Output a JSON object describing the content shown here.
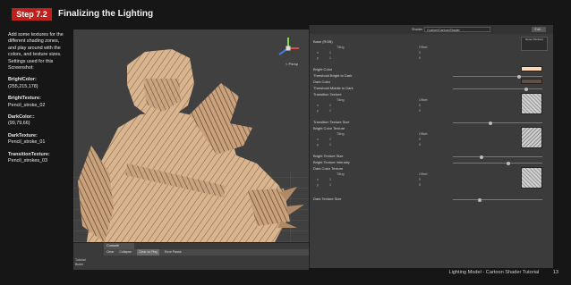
{
  "slide": {
    "step": "Step 7.2",
    "title": "Finalizing the Lighting",
    "footer_text": "Lighting Model - Cartoon Shader Tutorial",
    "page_number": "13"
  },
  "notes": {
    "intro": "Add some textures for the different shading zones, and play around with the colors, and texture sizes. Settings used for this Screenshot:",
    "items": [
      {
        "key": "BrightColor:",
        "value": "(255,215,178)"
      },
      {
        "key": "BrightTexture:",
        "value": "Pencil_stroke_02"
      },
      {
        "key": "DarkColor::",
        "value": "(99,79,66)"
      },
      {
        "key": "DarkTexture:",
        "value": "Pencil_stroke_01"
      },
      {
        "key": "TransitionTexture:",
        "value": "Pencil_strokes_03"
      }
    ]
  },
  "viewport": {
    "persp_label": "< Persp"
  },
  "console": {
    "tab_label": "Console",
    "buttons": [
      "Clear",
      "Collapse",
      "Clear on Play",
      "Error Pause"
    ],
    "hierarchy_items": [
      "Tutorial",
      "Bullet"
    ]
  },
  "inspector": {
    "shader_label": "Shader",
    "shader_value": "Custom/CartoonShader",
    "edit_label": "Edit...",
    "preview_label": "None (Texture)",
    "tiling_label": "Tiling",
    "offset_label": "Offset",
    "x_label": "x",
    "y_label": "y",
    "tiling_x": "1",
    "tiling_y": "1",
    "offset_x": "0",
    "offset_y": "0",
    "properties": {
      "base": "Base (RGB)",
      "bright_color": "Bright Color",
      "threshold_bright_dark": "Threshold Bright to Dark",
      "dark_color": "Dark Color",
      "threshold_middle_dark": "Threshold Middle to Dark",
      "transition_texture": "Transition Texture",
      "transition_texture_size": "Transition Texture Size",
      "bright_color_texture": "Bright Color Texture",
      "bright_texture_size": "Bright Texture Size",
      "bright_texture_intensity": "Bright Texture Intensity",
      "dark_color_texture": "Dark Color Texture",
      "dark_texture_size": "Dark Texture Size"
    },
    "colors": {
      "bright": "#ffd7b2",
      "dark": "#634f42"
    }
  }
}
